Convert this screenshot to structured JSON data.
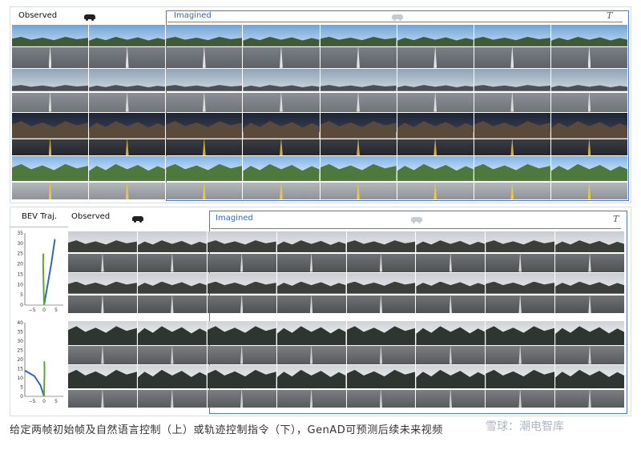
{
  "top_panel": {
    "observed_label": "Observed",
    "imagined_label": "Imagined",
    "time_label": "T",
    "scene_count": 4,
    "frames_per_row": 8
  },
  "bottom_panel": {
    "bev_label": "BEV Traj.",
    "observed_label": "Observed",
    "imagined_label": "Imagined",
    "time_label": "T",
    "plots": [
      {
        "y_ticks": [
          "35",
          "30",
          "25",
          "20",
          "15",
          "10",
          "5",
          "0"
        ],
        "x_ticks": [
          "−5",
          "0",
          "5"
        ],
        "blue_curve": [
          [
            0,
            0
          ],
          [
            1.5,
            10
          ],
          [
            3,
            20
          ],
          [
            4.5,
            32
          ]
        ],
        "green_curve": [
          [
            0,
            0
          ],
          [
            -0.2,
            10
          ],
          [
            -0.4,
            20
          ],
          [
            -0.3,
            25
          ]
        ]
      },
      {
        "y_ticks": [
          "40",
          "35",
          "30",
          "25",
          "20",
          "15",
          "10",
          "5",
          "0"
        ],
        "x_ticks": [
          "−5",
          "0",
          "5"
        ],
        "blue_curve": [
          [
            -8,
            14
          ],
          [
            -4,
            11
          ],
          [
            -1.5,
            6
          ],
          [
            0,
            0
          ]
        ],
        "green_curve": [
          [
            0,
            0
          ],
          [
            0.1,
            8
          ],
          [
            0.2,
            14
          ],
          [
            0.1,
            19
          ]
        ]
      }
    ]
  },
  "caption": "给定两帧初始帧及自然语言控制（上）或轨迹控制指令（下），GenAD可预测后续未来视频",
  "watermark": "雪球：潮电智库",
  "colors": {
    "imagined_border": "#4a78c8",
    "blue_traj": "#3566b8",
    "green_traj": "#5aa832"
  }
}
